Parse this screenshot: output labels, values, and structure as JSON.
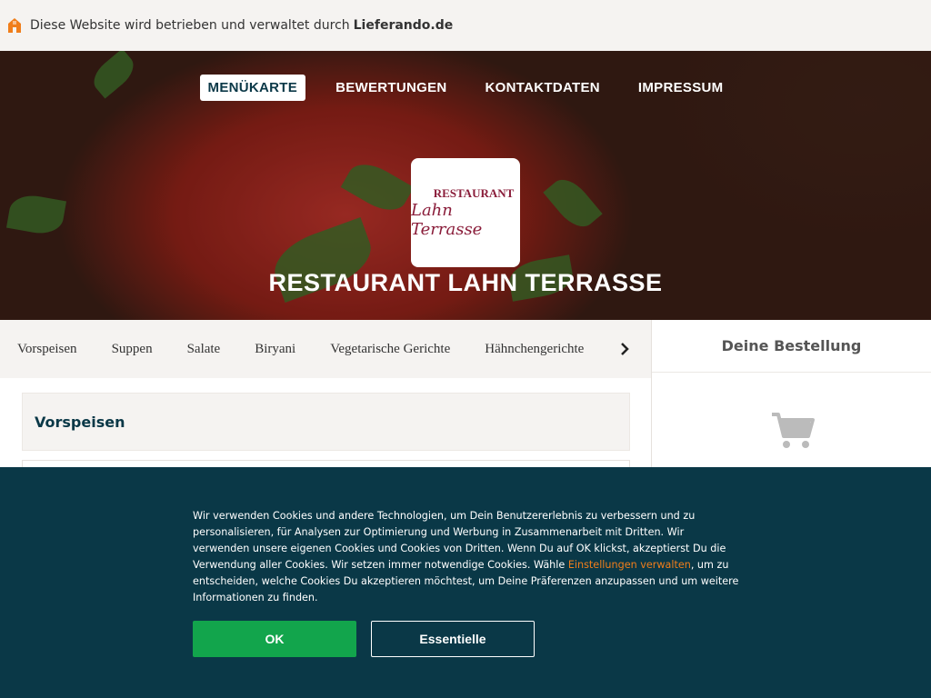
{
  "topbar": {
    "text": "Diese Website wird betrieben und verwaltet durch",
    "brand": "Lieferando.de"
  },
  "nav": {
    "items": [
      "MENÜKARTE",
      "BEWERTUNGEN",
      "KONTAKTDATEN",
      "IMPRESSUM"
    ],
    "active_index": 0
  },
  "restaurant": {
    "logo_line1": "RESTAURANT",
    "logo_line2": "Lahn Terrasse",
    "title": "RESTAURANT LAHN TERRASSE"
  },
  "categories": {
    "items": [
      "Vorspeisen",
      "Suppen",
      "Salate",
      "Biryani",
      "Vegetarische Gerichte",
      "Hähnchengerichte"
    ],
    "next_icon": "chevron-right-icon"
  },
  "main": {
    "section_title": "Vorspeisen"
  },
  "basket": {
    "title": "Deine Bestellung",
    "icon": "cart-icon"
  },
  "cookie": {
    "text_before_link": "Wir verwenden Cookies und andere Technologien, um Dein Benutzererlebnis zu verbessern und zu personalisieren, für Analysen zur Optimierung und Werbung in Zusammenarbeit mit Dritten. Wir verwenden unsere eigenen Cookies und Cookies von Dritten. Wenn Du auf OK klickst, akzeptierst Du die Verwendung aller Cookies. Wir setzen immer notwendige Cookies. Wähle ",
    "link": "Einstellungen verwalten",
    "text_after_link": ", um zu entscheiden, welche Cookies Du akzeptieren möchtest, um Deine Präferenzen anzupassen und um weitere Informationen zu finden.",
    "ok_label": "OK",
    "essential_label": "Essentielle"
  },
  "colors": {
    "brand_orange": "#f07e1b",
    "banner_bg": "#0a3847",
    "ok_green": "#12a54c"
  }
}
